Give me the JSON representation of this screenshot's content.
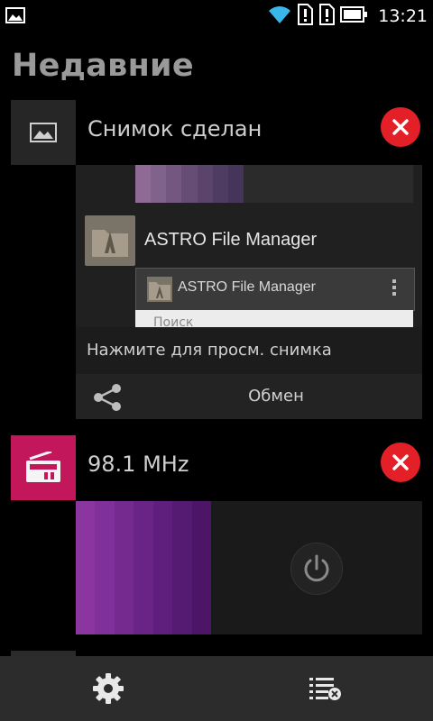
{
  "status_bar": {
    "time": "13:21",
    "icons": [
      "image-icon",
      "wifi-icon",
      "sim1-alert-icon",
      "sim2-alert-icon",
      "battery-icon"
    ]
  },
  "header": {
    "title": "Недавние"
  },
  "cards": [
    {
      "icon": "gallery-icon",
      "title": "Снимок сделан",
      "preview": {
        "app_title": "ASTRO File Manager",
        "dialog_title": "ASTRO File Manager",
        "search_placeholder": "Поиск"
      },
      "hint": "Нажмите для просм. снимка",
      "action_label": "Обмен",
      "action_icon": "share-icon"
    },
    {
      "icon": "radio-icon",
      "title": "98.1 MHz",
      "accent_color": "#c2185b",
      "control_icon": "power-icon"
    }
  ],
  "bottom_bar": {
    "left_icon": "settings-gear-icon",
    "right_icon": "clear-list-icon"
  },
  "colors": {
    "close": "#e32028",
    "radio_accent": "#c2185b"
  }
}
